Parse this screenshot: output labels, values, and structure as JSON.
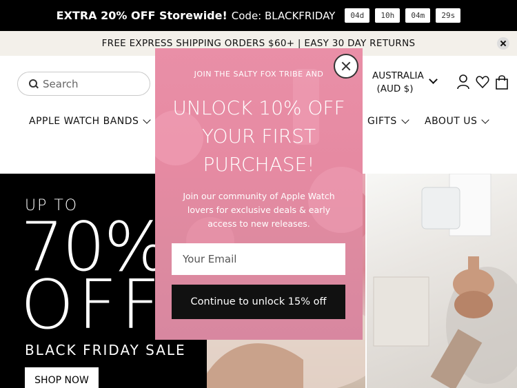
{
  "promo": {
    "headline": "EXTRA 20% OFF Storewide!",
    "code_text": "Code: BLACKFRIDAY",
    "timer": {
      "days": "04d",
      "hours": "10h",
      "minutes": "04m",
      "seconds": "29s"
    }
  },
  "shipping": {
    "text": "FREE EXPRESS SHIPPING ORDERS $60+ | EASY 30 DAY RETURNS"
  },
  "header": {
    "search_placeholder": "Search",
    "currency_line1": "AUSTRALIA",
    "currency_line2": "(AUD $)"
  },
  "nav": {
    "items": [
      {
        "label": "APPLE WATCH BANDS"
      },
      {
        "label": "GIFTS"
      },
      {
        "label": "ABOUT US"
      }
    ]
  },
  "hero": {
    "upto": "UP TO",
    "percent": "70%",
    "off": "OFF",
    "sale": "BLACK FRIDAY SALE",
    "cta": "SHOP NOW"
  },
  "modal": {
    "pre_title": "JOIN THE SALTY FOX TRIBE AND",
    "title_line1": "UNLOCK 10% OFF",
    "title_line2": "YOUR FIRST",
    "title_line3": "PURCHASE!",
    "description": "Join our community of Apple Watch lovers for exclusive deals & early access to new releases.",
    "email_placeholder": "Your Email",
    "submit_label": "Continue to unlock 15% off"
  },
  "colors": {
    "modal_pink": "#e68aa2",
    "promo_black": "#000000",
    "ship_bar": "#f3f0ea"
  }
}
